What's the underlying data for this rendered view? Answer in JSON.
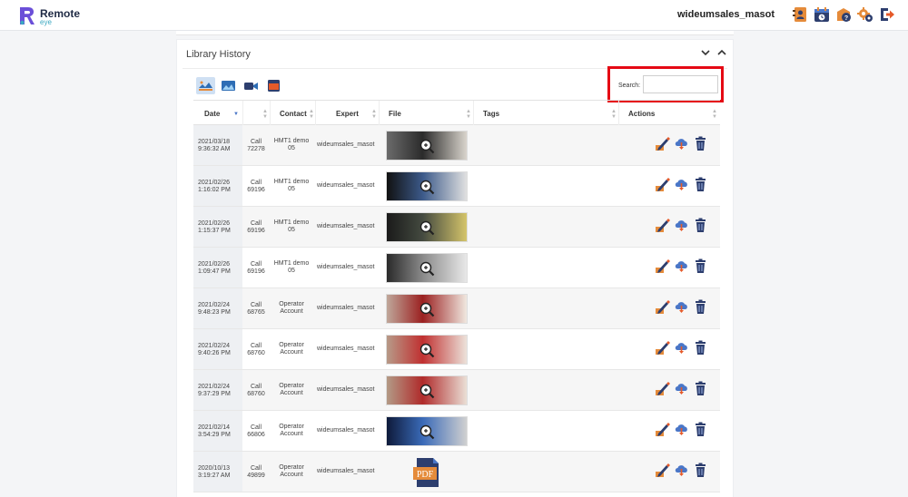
{
  "header": {
    "logo_name": "Remote",
    "logo_sub": "eye",
    "username": "wideumsales_masot",
    "icons": [
      "contacts-icon",
      "calendar-icon",
      "help-icon",
      "settings-icon",
      "logout-icon"
    ]
  },
  "panel": {
    "title": "Library History",
    "filters": [
      "all-media-filter-icon",
      "image-filter-icon",
      "video-filter-icon",
      "document-filter-icon"
    ]
  },
  "search": {
    "label": "Search:",
    "value": "",
    "placeholder": ""
  },
  "table": {
    "columns": [
      "Date",
      "",
      "Contact",
      "Expert",
      "File",
      "Tags",
      "Actions"
    ],
    "rows": [
      {
        "date": "2021/03/18",
        "time": "9:36:32 AM",
        "call": "Call",
        "call_id": "72278",
        "contact_1": "HMT1 demo",
        "contact_2": "05",
        "expert": "wideumsales_masot",
        "file": "image",
        "tags": ""
      },
      {
        "date": "2021/02/26",
        "time": "1:16:02 PM",
        "call": "Call",
        "call_id": "69196",
        "contact_1": "HMT1 demo",
        "contact_2": "05",
        "expert": "wideumsales_masot",
        "file": "image",
        "tags": ""
      },
      {
        "date": "2021/02/26",
        "time": "1:15:37 PM",
        "call": "Call",
        "call_id": "69196",
        "contact_1": "HMT1 demo",
        "contact_2": "05",
        "expert": "wideumsales_masot",
        "file": "image",
        "tags": ""
      },
      {
        "date": "2021/02/26",
        "time": "1:09:47 PM",
        "call": "Call",
        "call_id": "69196",
        "contact_1": "HMT1 demo",
        "contact_2": "05",
        "expert": "wideumsales_masot",
        "file": "image",
        "tags": ""
      },
      {
        "date": "2021/02/24",
        "time": "9:48:23 PM",
        "call": "Call",
        "call_id": "68765",
        "contact_1": "Operator",
        "contact_2": "Account",
        "expert": "wideumsales_masot",
        "file": "image",
        "tags": ""
      },
      {
        "date": "2021/02/24",
        "time": "9:40:26 PM",
        "call": "Call",
        "call_id": "68760",
        "contact_1": "Operator",
        "contact_2": "Account",
        "expert": "wideumsales_masot",
        "file": "image",
        "tags": ""
      },
      {
        "date": "2021/02/24",
        "time": "9:37:29 PM",
        "call": "Call",
        "call_id": "68760",
        "contact_1": "Operator",
        "contact_2": "Account",
        "expert": "wideumsales_masot",
        "file": "image",
        "tags": ""
      },
      {
        "date": "2021/02/14",
        "time": "3:54:29 PM",
        "call": "Call",
        "call_id": "66806",
        "contact_1": "Operator",
        "contact_2": "Account",
        "expert": "wideumsales_masot",
        "file": "image",
        "tags": ""
      },
      {
        "date": "2020/10/13",
        "time": "3:19:27 AM",
        "call": "Call",
        "call_id": "49899",
        "contact_1": "Operator",
        "contact_2": "Account",
        "expert": "wideumsales_masot",
        "file": "pdf",
        "file_label": "PDF",
        "tags": ""
      }
    ]
  },
  "colors": {
    "accent": "#4a76c7",
    "highlight": "#e50914",
    "brand": "#1f2a44"
  }
}
